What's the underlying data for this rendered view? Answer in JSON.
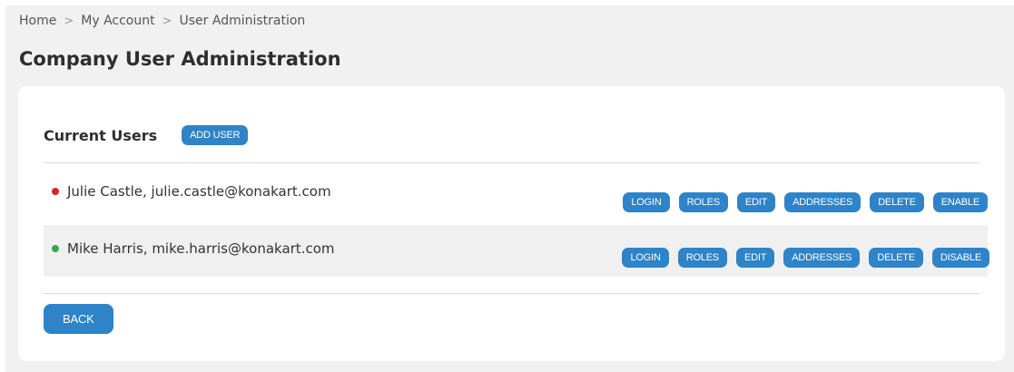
{
  "breadcrumb": {
    "items": [
      "Home",
      "My Account",
      "User Administration"
    ],
    "separator": ">"
  },
  "page_title": "Company User Administration",
  "section": {
    "title": "Current Users",
    "add_user_label": "ADD USER"
  },
  "users": [
    {
      "text": "Julie Castle, julie.castle@konakart.com",
      "status_color": "#d9251d",
      "actions": [
        "LOGIN",
        "ROLES",
        "EDIT",
        "ADDRESSES",
        "DELETE",
        "ENABLE"
      ]
    },
    {
      "text": "Mike Harris, mike.harris@konakart.com",
      "status_color": "#3aa74a",
      "actions": [
        "LOGIN",
        "ROLES",
        "EDIT",
        "ADDRESSES",
        "DELETE",
        "DISABLE"
      ]
    }
  ],
  "back_label": "BACK",
  "colors": {
    "accent": "#2f83c7",
    "page_background": "#f1f1f1",
    "card_background": "#ffffff",
    "alt_row_background": "#f0f0f0"
  }
}
